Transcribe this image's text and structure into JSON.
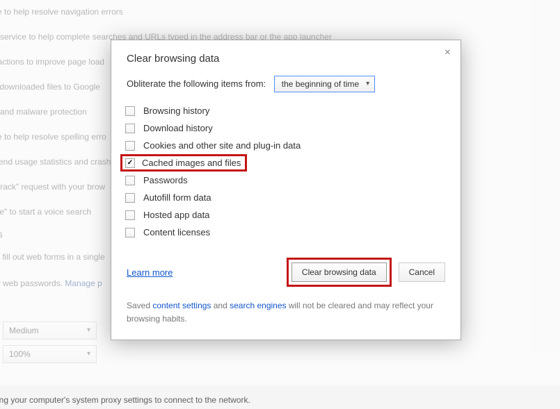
{
  "bg": {
    "lines": [
      "ce to help resolve navigation errors",
      "n service to help complete searches and URLs typed in the address bar or the app launcher",
      "t actions to improve page load",
      "s downloaded files to Google",
      "g and malware protection",
      "ce to help resolve spelling erro",
      "Send usage statistics and crash",
      " Track\" request with your brow",
      "gle\" to start a voice search"
    ],
    "section": "ns",
    "form1": "to fill out web forms in a single",
    "form2a": "ur web passwords.  ",
    "form2b": "Manage p",
    "sel1": "Medium",
    "sel2": "100%",
    "proxy": "sing your computer's system proxy settings to connect to the network."
  },
  "dialog": {
    "title": "Clear browsing data",
    "obliterate": "Obliterate the following items from:",
    "time": "the beginning of time",
    "checks": [
      {
        "label": "Browsing history",
        "checked": false,
        "hl": false
      },
      {
        "label": "Download history",
        "checked": false,
        "hl": false
      },
      {
        "label": "Cookies and other site and plug-in data",
        "checked": false,
        "hl": false
      },
      {
        "label": "Cached images and files",
        "checked": true,
        "hl": true
      },
      {
        "label": "Passwords",
        "checked": false,
        "hl": false
      },
      {
        "label": "Autofill form data",
        "checked": false,
        "hl": false
      },
      {
        "label": "Hosted app data",
        "checked": false,
        "hl": false
      },
      {
        "label": "Content licenses",
        "checked": false,
        "hl": false
      }
    ],
    "learn": "Learn more",
    "clearbtn": "Clear browsing data",
    "cancel": "Cancel",
    "foot1": "Saved ",
    "foot2": "content settings",
    "foot3": " and ",
    "foot4": "search engines",
    "foot5": " will not be cleared and may reflect your browsing habits."
  }
}
